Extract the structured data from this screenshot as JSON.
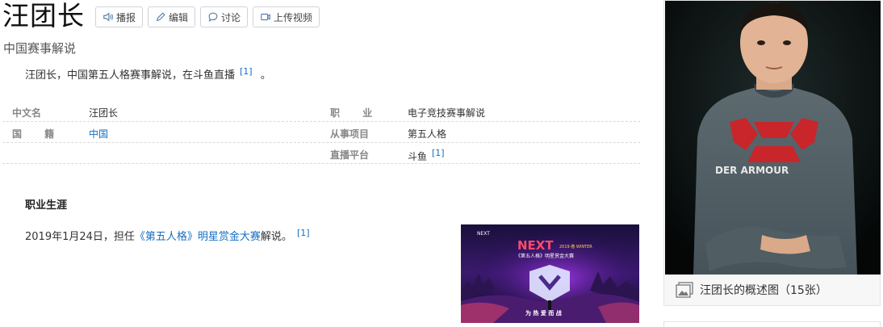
{
  "header": {
    "title": "汪团长",
    "buttons": [
      {
        "label": "播报",
        "icon": "speaker-icon"
      },
      {
        "label": "编辑",
        "icon": "pencil-icon"
      },
      {
        "label": "讨论",
        "icon": "chat-bubble-icon"
      },
      {
        "label": "上传视频",
        "icon": "video-icon"
      }
    ]
  },
  "subtitle": "中国赛事解说",
  "summary": {
    "text": "汪团长，中国第五人格赛事解说，在斗鱼直播",
    "ref": "[1]",
    "end": "。"
  },
  "info": {
    "rows": [
      {
        "label1": "中文名",
        "value1": "汪团长",
        "label2": "职 业",
        "value2": "电子竞技赛事解说"
      },
      {
        "label1": "国 籍",
        "value1": "中国",
        "label2": "从事项目",
        "value2": "第五人格"
      },
      {
        "label1": "",
        "value1": "",
        "label2": "直播平台",
        "value2": "斗鱼",
        "ref2": "[1]"
      }
    ]
  },
  "career": {
    "section_title": "职业生涯",
    "text_before": "2019年1月24日，担任",
    "link": "《第五人格》明星赏金大赛",
    "text_after": "解说。",
    "ref": "[1]"
  },
  "poster": {
    "brand": "NEXT",
    "season": "2019·春 WINTER",
    "event": "《第五人格》明星赏金大赛",
    "slogan": "为 热 爱 而 战"
  },
  "summary_pic": {
    "caption": "汪团长的概述图（15张）",
    "shirt_text": "DER ARMOUR"
  },
  "colors": {
    "link": "#136ec2",
    "label": "#888888"
  }
}
